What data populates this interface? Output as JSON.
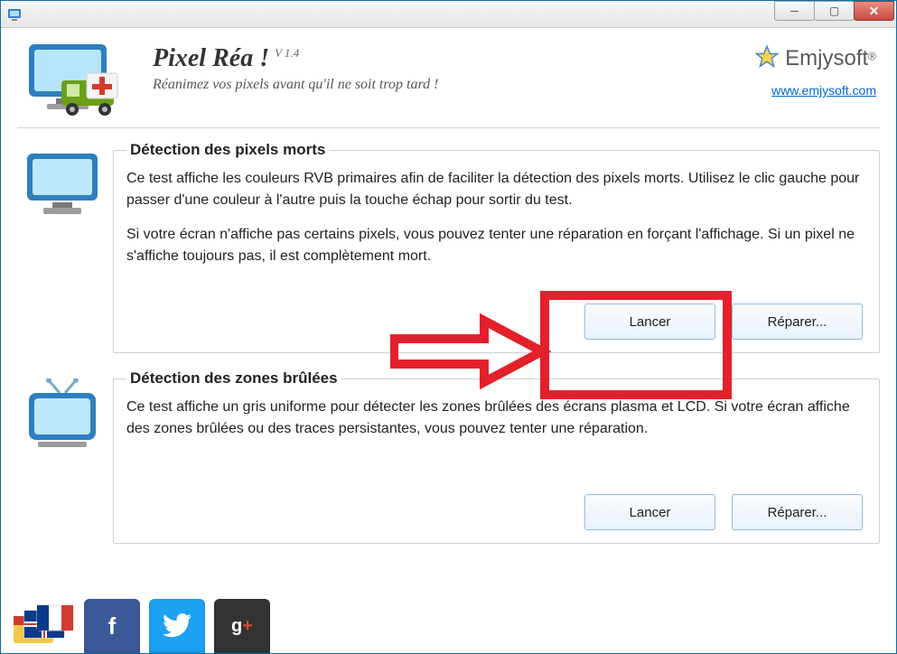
{
  "header": {
    "title": "Pixel Réa !",
    "version": "V 1.4",
    "tagline": "Réanimez vos pixels avant qu'il ne soit trop tard !",
    "brand": "Emjysoft",
    "brand_reg": "®",
    "brand_url": "www.emjysoft.com"
  },
  "sections": {
    "dead_pixels": {
      "legend": "Détection des pixels morts",
      "p1": "Ce test affiche les couleurs RVB primaires afin de faciliter la détection des pixels morts. Utilisez le clic gauche pour passer d'une couleur à l'autre puis la touche échap pour sortir du test.",
      "p2": "Si votre écran n'affiche pas certains pixels, vous pouvez tenter une réparation en forçant l'affichage. Si un pixel ne s'affiche toujours pas, il est complètement mort.",
      "launch": "Lancer",
      "repair": "Réparer..."
    },
    "burnt_zones": {
      "legend": "Détection des zones brûlées",
      "p1": "Ce test affiche un gris uniforme pour détecter les zones brûlées des écrans plasma et LCD. Si votre écran affiche des zones brûlées ou des traces persistantes, vous pouvez tenter une réparation.",
      "launch": "Lancer",
      "repair": "Réparer..."
    }
  },
  "social": {
    "facebook": "f",
    "twitter": "t",
    "google_g": "g",
    "google_plus": "+"
  }
}
